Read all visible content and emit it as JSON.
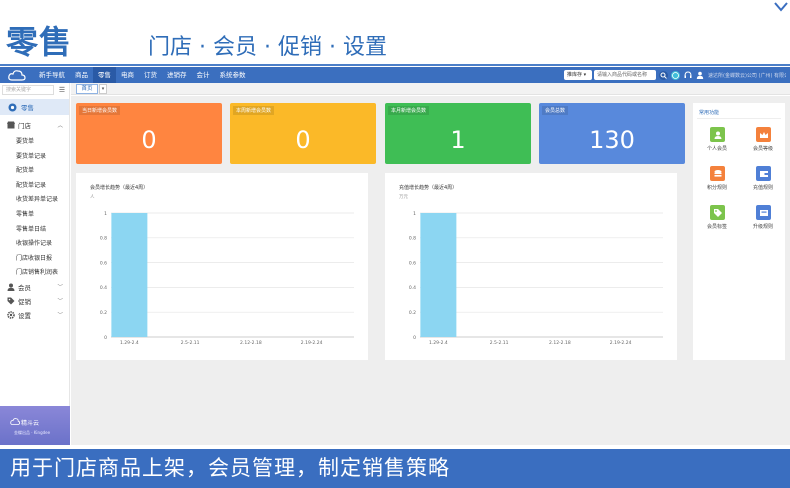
{
  "banner": {
    "title": "零售",
    "subtitle": "门店 · 会员 · 促销 · 设置"
  },
  "topnav": {
    "items": [
      "新手导航",
      "商品",
      "零售",
      "电商",
      "订货",
      "进销存",
      "会计",
      "系统参数"
    ],
    "active_index": 2,
    "store_select": "推库存 ▾",
    "search_placeholder": "请输入商品代码或名称",
    "user_text": "速达所(金蝶数云)公司 (广州) 有限公司"
  },
  "sidebar": {
    "search_placeholder": "搜索关键字",
    "home_label": "零售",
    "store_group": "门店",
    "store_items": [
      "要货单",
      "要货单记录",
      "配货单",
      "配货单记录",
      "收货差异单记录",
      "零售单",
      "零售单日结",
      "收银操作记录",
      "门店收银日报",
      "门店销售利润表"
    ],
    "member_group": "会员",
    "promo_group": "促销",
    "settings_group": "设置",
    "promo_brand": "精斗云",
    "promo_sub": "金蝶出品 · Kingdee"
  },
  "tabs": {
    "home": "首页"
  },
  "cards": [
    {
      "label": "当日新增会员数",
      "value": "0",
      "color": "#ff8540"
    },
    {
      "label": "本周新增会员数",
      "value": "0",
      "color": "#fbb928"
    },
    {
      "label": "本月新增会员数",
      "value": "1",
      "color": "#3fbe55"
    },
    {
      "label": "会员总数",
      "value": "130",
      "color": "#5889dc"
    }
  ],
  "charts": [
    {
      "title": "会员增长趋势（最近4周）",
      "unit": "人",
      "chart_data": {
        "type": "bar",
        "categories": [
          "1.29-2.4",
          "2.5-2.11",
          "2.12-2.18",
          "2.19-2.24"
        ],
        "values": [
          1,
          0,
          0,
          0
        ],
        "ylim": [
          0,
          1
        ],
        "yticks": [
          "0",
          "0.2",
          "0.4",
          "0.6",
          "0.8",
          "1"
        ],
        "grid": true,
        "bar_color": "#8cd6f2"
      }
    },
    {
      "title": "充值增长趋势（最近4周）",
      "unit": "万元",
      "chart_data": {
        "type": "bar",
        "categories": [
          "1.29-2.4",
          "2.5-2.11",
          "2.12-2.18",
          "2.19-2.24"
        ],
        "values": [
          1,
          0,
          0,
          0
        ],
        "ylim": [
          0,
          1
        ],
        "yticks": [
          "0",
          "0.2",
          "0.4",
          "0.6",
          "0.8",
          "1"
        ],
        "grid": true,
        "bar_color": "#8cd6f2"
      }
    }
  ],
  "quick": {
    "title": "常用功能",
    "items": [
      {
        "label": "个人会员",
        "icon": "person-icon",
        "color": "#7cc44c"
      },
      {
        "label": "会员等级",
        "icon": "crown-icon",
        "color": "#f4813c"
      },
      {
        "label": "积分规则",
        "icon": "database-icon",
        "color": "#f4813c"
      },
      {
        "label": "充值规则",
        "icon": "wallet-icon",
        "color": "#4f7fd6"
      },
      {
        "label": "会员标签",
        "icon": "tag-icon",
        "color": "#7cc44c"
      },
      {
        "label": "升级规则",
        "icon": "upgrade-icon",
        "color": "#4f7fd6"
      }
    ]
  },
  "caption": "用于门店商品上架，会员管理，制定销售策略"
}
